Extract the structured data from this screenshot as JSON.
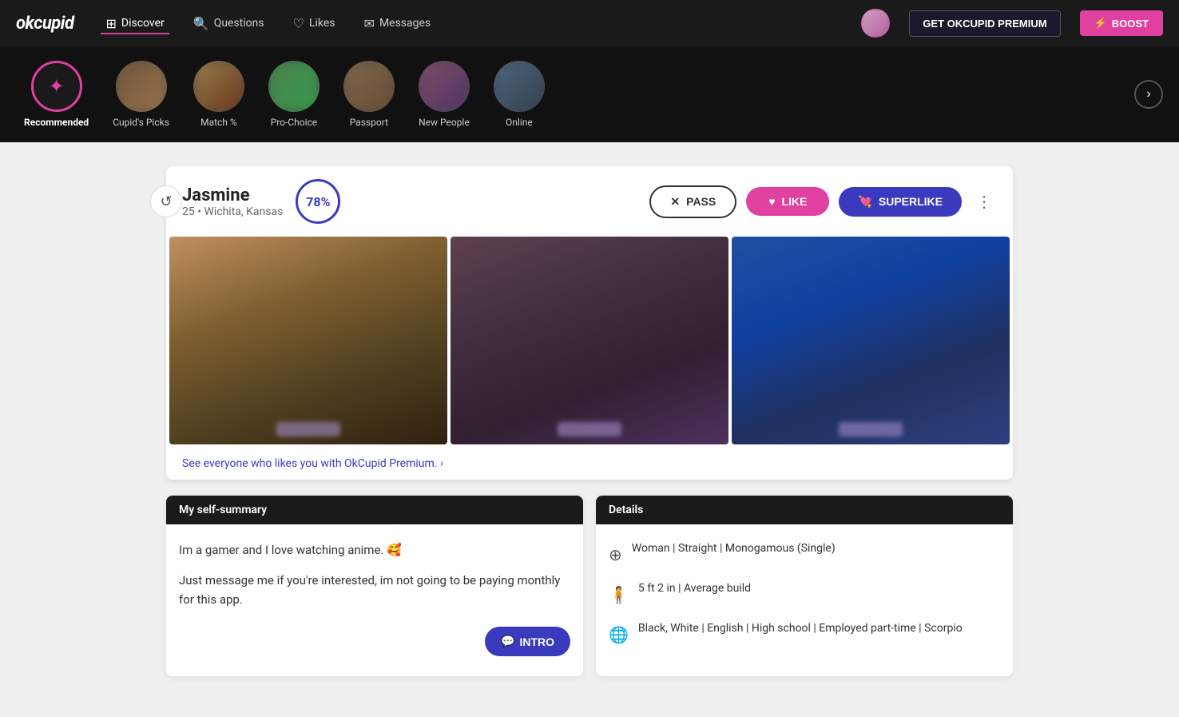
{
  "app": {
    "logo": "okcupid",
    "nav_items": [
      {
        "label": "Discover",
        "icon": "⊞",
        "active": true
      },
      {
        "label": "Questions",
        "icon": "?"
      },
      {
        "label": "Likes",
        "icon": "♡"
      },
      {
        "label": "Messages",
        "icon": "✉"
      }
    ],
    "btn_premium": "GET OKCUPID PREMIUM",
    "btn_boost": "BOOST"
  },
  "categories": [
    {
      "id": "recommended",
      "label": "Recommended",
      "active": true,
      "special": true
    },
    {
      "id": "cupids-picks",
      "label": "Cupid's Picks",
      "active": false
    },
    {
      "id": "match",
      "label": "Match %",
      "active": false
    },
    {
      "id": "pro-choice",
      "label": "Pro-Choice",
      "active": false
    },
    {
      "id": "passport",
      "label": "Passport",
      "active": false
    },
    {
      "id": "new-people",
      "label": "New People",
      "active": false
    },
    {
      "id": "online",
      "label": "Online",
      "active": false
    }
  ],
  "profile": {
    "name": "Jasmine",
    "age": "25",
    "location": "Wichita, Kansas",
    "match_percent": "78%",
    "pass_label": "PASS",
    "like_label": "LIKE",
    "superlike_label": "SUPERLIKE",
    "premium_link": "See everyone who likes you with OkCupid Premium. ›",
    "self_summary_header": "My self-summary",
    "self_summary_p1": "Im a gamer and I love watching anime. 🥰",
    "self_summary_p2": "Just message me if you're interested, im not going to be paying monthly for this app.",
    "intro_label": "INTRO",
    "details_header": "Details",
    "detail_1": "Woman | Straight | Monogamous (Single)",
    "detail_2": "5 ft 2 in | Average build",
    "detail_3": "Black, White | English | High school | Employed part-time | Scorpio"
  }
}
